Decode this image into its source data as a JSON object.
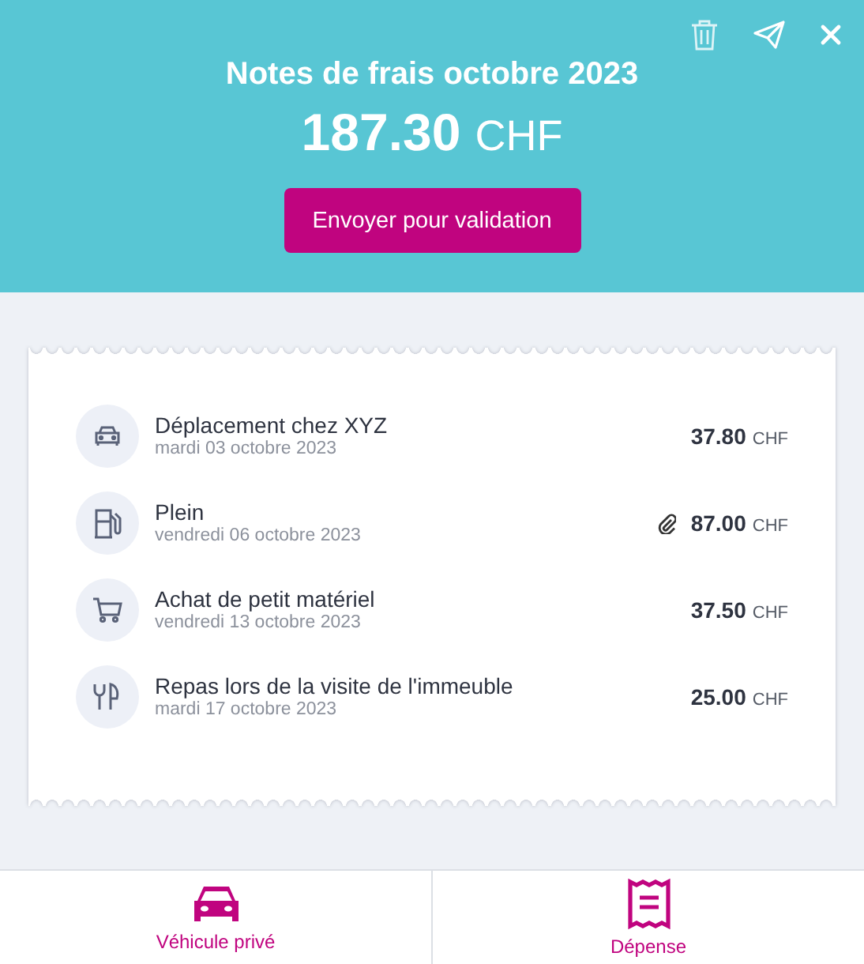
{
  "header": {
    "title": "Notes de frais octobre 2023",
    "amount": "187.30",
    "currency": "CHF",
    "submit_button": "Envoyer pour validation"
  },
  "expenses": [
    {
      "kind": "car",
      "title": "Déplacement chez XYZ",
      "date": "mardi 03 octobre 2023",
      "attachment": false,
      "amount": "37.80",
      "currency": "CHF"
    },
    {
      "kind": "fuel",
      "title": "Plein",
      "date": "vendredi 06 octobre 2023",
      "attachment": true,
      "amount": "87.00",
      "currency": "CHF"
    },
    {
      "kind": "cart",
      "title": "Achat de petit matériel",
      "date": "vendredi 13 octobre 2023",
      "attachment": false,
      "amount": "37.50",
      "currency": "CHF"
    },
    {
      "kind": "meal",
      "title": "Repas lors de la visite de l'immeuble",
      "date": "mardi 17 octobre 2023",
      "attachment": false,
      "amount": "25.00",
      "currency": "CHF"
    }
  ],
  "bottom_actions": [
    {
      "kind": "car",
      "label": "Véhicule privé"
    },
    {
      "kind": "receipt",
      "label": "Dépense"
    }
  ]
}
